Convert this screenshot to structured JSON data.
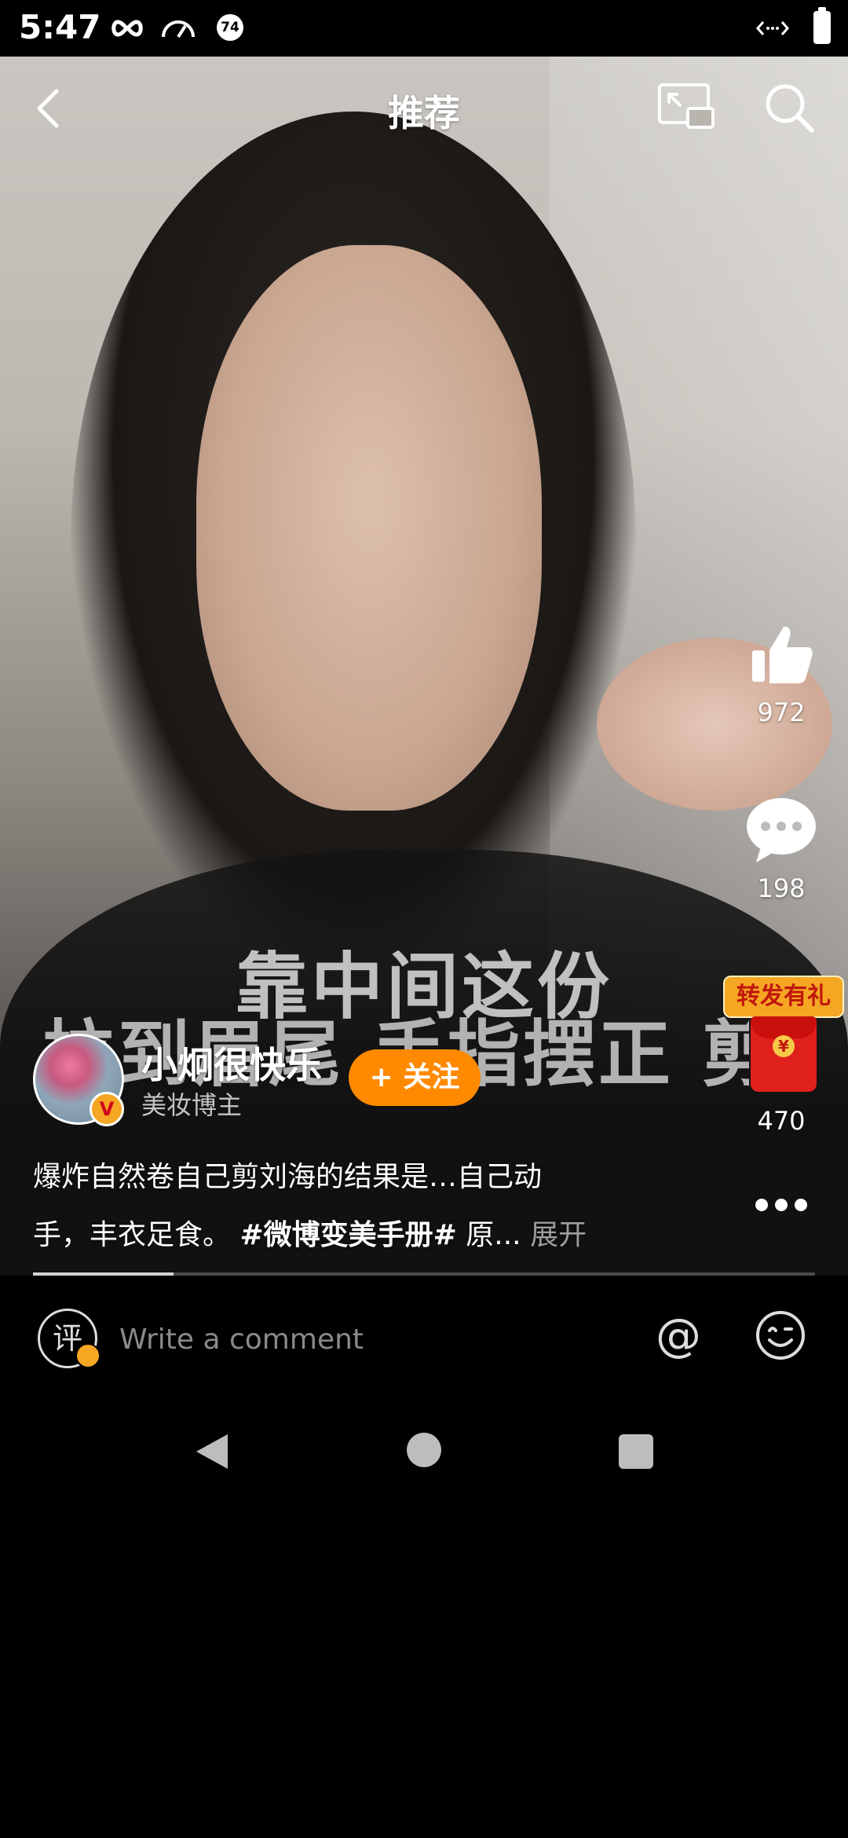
{
  "status_bar": {
    "time": "5:47",
    "battery_badge": "74"
  },
  "header": {
    "title": "推荐"
  },
  "video": {
    "subtitle_line1": "靠中间这份",
    "subtitle_line2": "拉到眉尾 手指摆正 剪掉"
  },
  "actions": {
    "like_count": "972",
    "comment_count": "198",
    "share_badge": "转发有礼",
    "share_count": "470",
    "coin_symbol": "¥"
  },
  "author": {
    "name": "小炯很快乐",
    "tag": "美妆博主",
    "verified_mark": "V",
    "follow_label": "+ 关注"
  },
  "caption": {
    "line1": "爆炸自然卷自己剪刘海的结果是…自己动",
    "line2_prefix": "手，丰衣足食。",
    "hashtag": "#微博变美手册#",
    "line2_suffix": "原...",
    "expand_label": "展开"
  },
  "progress": {
    "fraction": 0.18
  },
  "comment_bar": {
    "review_glyph": "评",
    "placeholder": "Write a comment",
    "at_glyph": "@"
  },
  "colors": {
    "accent": "#ff8a00",
    "badge": "#f5a623",
    "red_envelope": "#e0201c"
  },
  "icons": [
    "back-icon",
    "pip-icon",
    "search-icon",
    "thumbs-up-icon",
    "comment-bubble-icon",
    "red-envelope-icon",
    "more-icon",
    "at-icon",
    "emoji-icon"
  ]
}
